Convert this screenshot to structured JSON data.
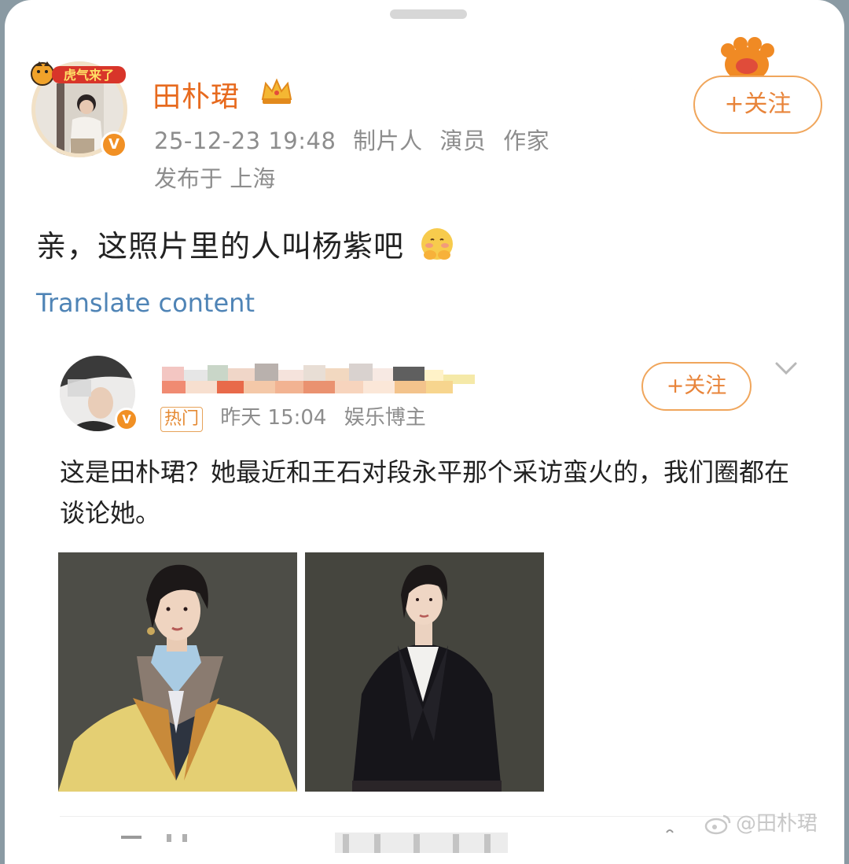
{
  "post": {
    "author": "田朴珺",
    "timestamp": "25-12-23 19:48",
    "tags": [
      "制片人",
      "演员",
      "作家"
    ],
    "location": "发布于 上海",
    "follow_label": "+关注",
    "text": "亲，这照片里的人叫杨紫吧",
    "translate_label": "Translate content"
  },
  "repost": {
    "hot_tag": "热门",
    "timestamp": "昨天 15:04",
    "role": "娱乐博主",
    "follow_label": "+关注",
    "text": "这是田朴珺？她最近和王石对段永平那个采访蛮火的，我们圈都在谈论她。"
  },
  "watermark": "@田朴珺",
  "icons": [
    "crown-icon",
    "verified-badge-icon",
    "tiger-sticker-icon",
    "chevron-down-icon",
    "weibo-logo-icon"
  ],
  "colors": {
    "accent": "#e8843a",
    "link": "#4f84b6",
    "meta": "#8d8d8d"
  }
}
